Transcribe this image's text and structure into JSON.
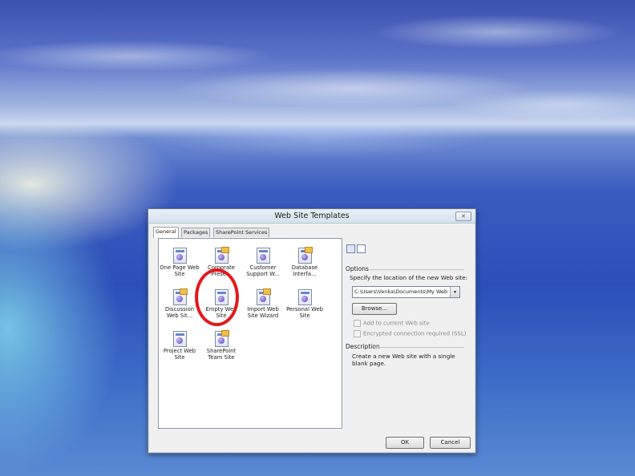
{
  "window": {
    "title": "Web Site Templates",
    "close_glyph": "✕"
  },
  "tabs": [
    {
      "label": "General",
      "active": true
    },
    {
      "label": "Packages",
      "active": false
    },
    {
      "label": "SharePoint Services",
      "active": false
    }
  ],
  "templates": [
    {
      "label": "One Page Web Site"
    },
    {
      "label": "Corporate Prese..."
    },
    {
      "label": "Customer Support W..."
    },
    {
      "label": "Database Interfa..."
    },
    {
      "label": "Discussion Web Sit..."
    },
    {
      "label": "Empty Web Site",
      "highlighted": true
    },
    {
      "label": "Import Web Site Wizard"
    },
    {
      "label": "Personal Web Site"
    },
    {
      "label": "Project Web Site"
    },
    {
      "label": "SharePoint Team Site"
    }
  ],
  "options": {
    "heading": "Options",
    "location_prompt": "Specify the location of the new Web site:",
    "location_value": "C:\\Users\\Venka\\Documents\\My Web Sites\\mysite",
    "browse_label": "Browse...",
    "add_to_current_label": "Add to current Web site",
    "ssl_label": "Encrypted connection required (SSL)"
  },
  "description": {
    "heading": "Description",
    "text": "Create a new Web site with a single blank page."
  },
  "buttons": {
    "ok": "OK",
    "cancel": "Cancel"
  },
  "colors": {
    "highlight_circle": "#e2181b"
  }
}
